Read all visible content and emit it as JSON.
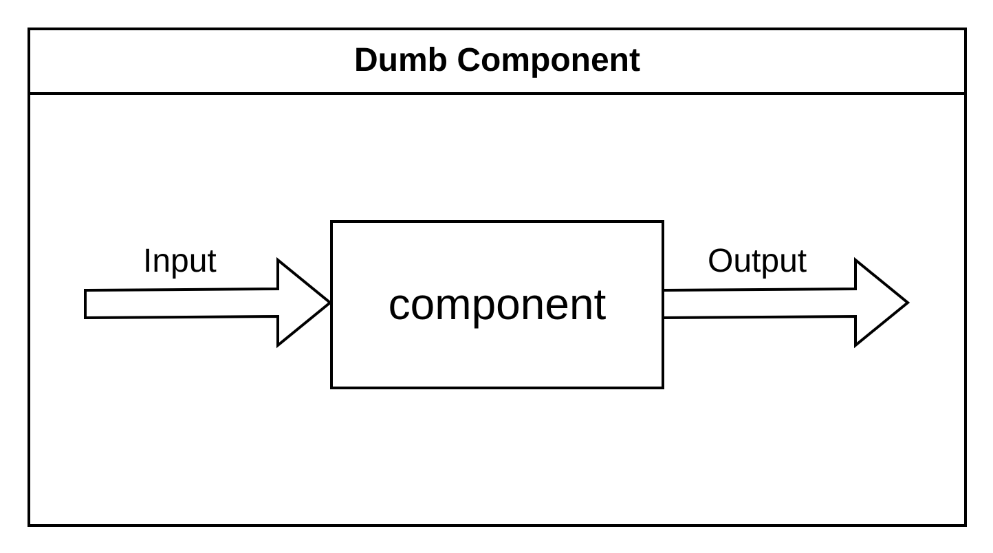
{
  "diagram": {
    "title": "Dumb Component",
    "center_node": {
      "label": "component"
    },
    "edges": [
      {
        "label": "Input",
        "direction": "into-component"
      },
      {
        "label": "Output",
        "direction": "out-of-component"
      }
    ],
    "colors": {
      "stroke": "#000000",
      "fill": "#ffffff",
      "text": "#000000"
    }
  }
}
